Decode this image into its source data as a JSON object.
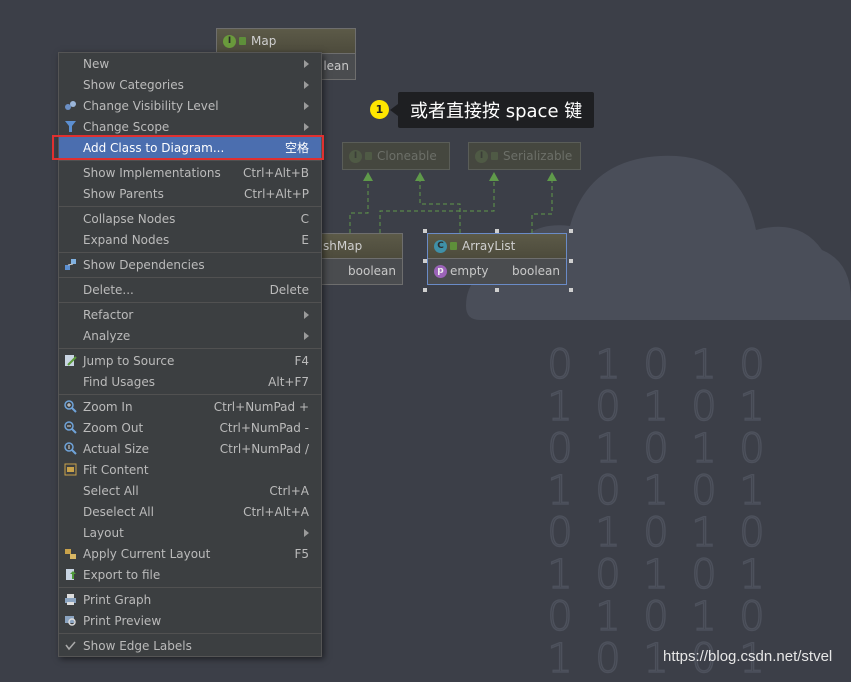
{
  "diagram": {
    "map_node": {
      "title": "Map",
      "row_type": "lean"
    },
    "cloneable": {
      "title": "Cloneable"
    },
    "serializable": {
      "title": "Serializable"
    },
    "hashmap_node": {
      "title": "shMap",
      "row_type": "boolean"
    },
    "arraylist_node": {
      "title": "ArrayList",
      "row_name": "empty",
      "row_type": "boolean"
    },
    "badge_interface": "I",
    "badge_class": "C",
    "badge_property": "p"
  },
  "menu": {
    "items": [
      {
        "label": "New",
        "shortcut": "",
        "submenu": true
      },
      {
        "label": "Show Categories",
        "shortcut": "",
        "submenu": true
      },
      {
        "label": "Change Visibility Level",
        "shortcut": "",
        "submenu": true,
        "icon": "visibility-icon"
      },
      {
        "label": "Change Scope",
        "shortcut": "",
        "submenu": true,
        "icon": "filter-icon"
      },
      {
        "label": "Add Class to Diagram...",
        "shortcut": "空格",
        "selected": true
      },
      {
        "label": "Show Implementations",
        "shortcut": "Ctrl+Alt+B"
      },
      {
        "label": "Show Parents",
        "shortcut": "Ctrl+Alt+P"
      },
      {
        "label": "Collapse Nodes",
        "shortcut": "C"
      },
      {
        "label": "Expand Nodes",
        "shortcut": "E"
      },
      {
        "label": "Show Dependencies",
        "shortcut": "",
        "icon": "dependencies-icon"
      },
      {
        "label": "Delete...",
        "shortcut": "Delete"
      },
      {
        "label": "Refactor",
        "shortcut": "",
        "submenu": true
      },
      {
        "label": "Analyze",
        "shortcut": "",
        "submenu": true
      },
      {
        "label": "Jump to Source",
        "shortcut": "F4",
        "icon": "edit-source-icon"
      },
      {
        "label": "Find Usages",
        "shortcut": "Alt+F7"
      },
      {
        "label": "Zoom In",
        "shortcut": "Ctrl+NumPad +",
        "icon": "zoom-in-icon"
      },
      {
        "label": "Zoom Out",
        "shortcut": "Ctrl+NumPad -",
        "icon": "zoom-out-icon"
      },
      {
        "label": "Actual Size",
        "shortcut": "Ctrl+NumPad /",
        "icon": "actual-size-icon"
      },
      {
        "label": "Fit Content",
        "shortcut": "",
        "icon": "fit-content-icon"
      },
      {
        "label": "Select All",
        "shortcut": "Ctrl+A"
      },
      {
        "label": "Deselect All",
        "shortcut": "Ctrl+Alt+A"
      },
      {
        "label": "Layout",
        "shortcut": "",
        "submenu": true
      },
      {
        "label": "Apply Current Layout",
        "shortcut": "F5",
        "icon": "apply-layout-icon"
      },
      {
        "label": "Export to file",
        "shortcut": "",
        "icon": "export-icon"
      },
      {
        "label": "Print Graph",
        "shortcut": "",
        "icon": "print-icon"
      },
      {
        "label": "Print Preview",
        "shortcut": "",
        "icon": "print-preview-icon"
      },
      {
        "label": "Show Edge Labels",
        "shortcut": "",
        "checked": true
      }
    ]
  },
  "callout": {
    "step": "1",
    "text": "或者直接按 space 键"
  },
  "digits": [
    [
      "0",
      "1",
      "0",
      "1",
      "0"
    ],
    [
      "1",
      "0",
      "1",
      "0",
      "1"
    ],
    [
      "0",
      "1",
      "0",
      "1",
      "0"
    ],
    [
      "1",
      "0",
      "1",
      "0",
      "1"
    ],
    [
      "0",
      "1",
      "0",
      "1",
      "0"
    ],
    [
      "1",
      "0",
      "1",
      "0",
      "1"
    ],
    [
      "0",
      "1",
      "0",
      "1",
      "0"
    ],
    [
      "1",
      "0",
      "1",
      "0",
      "1"
    ]
  ],
  "watermark": "https://blog.csdn.net/stvel",
  "colors": {
    "background": "#3c3f48",
    "menu_selected": "#4b6eaf",
    "highlight_border": "#e03030",
    "step_badge": "#ffe600"
  }
}
